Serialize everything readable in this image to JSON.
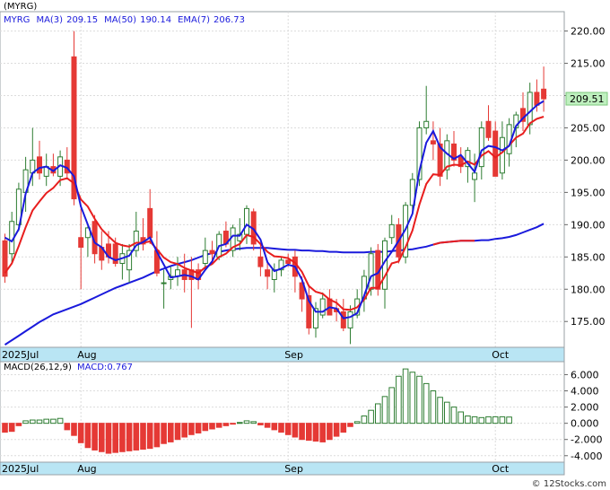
{
  "header": {
    "title": "(MYRG)"
  },
  "footer": {
    "credit": "© 12Stocks.com"
  },
  "colors": {
    "up": "#2e7d32",
    "down": "#e53935",
    "ma3": "#1a1adc",
    "ma50": "#1a1adc",
    "ema7": "#e81e1e",
    "macd_neg": "#e53935",
    "macd_pos": "#2e7d32",
    "axis_band": "#b9e5f4",
    "price_tag": "#bff0bf"
  },
  "chart_data": [
    {
      "type": "candlestick",
      "legend": [
        {
          "label": "MYRG",
          "value": ""
        },
        {
          "label": "MA(3)",
          "value": "209.15"
        },
        {
          "label": "MA(50)",
          "value": "190.14"
        },
        {
          "label": "EMA(7)",
          "value": "206.73"
        }
      ],
      "ylim": [
        171,
        223
      ],
      "yticks": [
        "220.00",
        "215.00",
        "210.00",
        "205.00",
        "200.00",
        "195.00",
        "190.00",
        "185.00",
        "180.00",
        "175.00"
      ],
      "ytick_values": [
        220,
        215,
        210,
        205,
        200,
        195,
        190,
        185,
        180,
        175
      ],
      "xticks": [
        {
          "label": "2025Jul",
          "index": 0
        },
        {
          "label": "Aug",
          "index": 11
        },
        {
          "label": "Sep",
          "index": 41
        },
        {
          "label": "Oct",
          "index": 71
        }
      ],
      "last_price": "209.51",
      "last_price_value": 209.51,
      "ohlc": [
        [
          187.5,
          188.6,
          181.0,
          182.0
        ],
        [
          185.5,
          192.0,
          184.0,
          190.5
        ],
        [
          190.0,
          196.5,
          189.0,
          195.5
        ],
        [
          195.0,
          200.5,
          192.0,
          198.5
        ],
        [
          198.0,
          205.0,
          196.0,
          200.0
        ],
        [
          200.5,
          203.0,
          197.0,
          198.0
        ],
        [
          197.5,
          201.0,
          196.0,
          199.0
        ],
        [
          199.0,
          201.0,
          197.5,
          198.0
        ],
        [
          197.5,
          201.5,
          196.0,
          200.5
        ],
        [
          200.0,
          202.0,
          197.0,
          198.0
        ],
        [
          216.0,
          220.0,
          193.0,
          194.0
        ],
        [
          188.0,
          192.5,
          180.0,
          186.5
        ],
        [
          188.0,
          190.0,
          185.0,
          189.5
        ],
        [
          190.5,
          191.5,
          184.0,
          185.5
        ],
        [
          186.5,
          189.0,
          183.0,
          184.5
        ],
        [
          187.0,
          189.0,
          184.0,
          185.0
        ],
        [
          187.0,
          188.0,
          183.5,
          184.0
        ],
        [
          184.0,
          187.0,
          181.5,
          185.5
        ],
        [
          183.0,
          187.0,
          181.0,
          186.0
        ],
        [
          186.0,
          192.0,
          185.0,
          189.0
        ],
        [
          188.0,
          191.0,
          186.0,
          187.0
        ],
        [
          192.5,
          195.5,
          187.0,
          188.0
        ],
        [
          186.0,
          189.0,
          182.0,
          182.5
        ],
        [
          181.0,
          183.0,
          177.0,
          181.0
        ],
        [
          181.5,
          183.5,
          180.0,
          182.0
        ],
        [
          182.0,
          185.0,
          180.5,
          183.0
        ],
        [
          183.0,
          185.5,
          179.5,
          181.5
        ],
        [
          183.0,
          185.0,
          174.0,
          181.5
        ],
        [
          183.0,
          184.0,
          180.0,
          181.5
        ],
        [
          184.0,
          188.0,
          183.0,
          186.0
        ],
        [
          186.0,
          187.5,
          184.0,
          185.5
        ],
        [
          185.0,
          189.0,
          184.5,
          188.5
        ],
        [
          189.0,
          190.5,
          186.5,
          187.0
        ],
        [
          186.0,
          190.0,
          185.0,
          189.5
        ],
        [
          187.5,
          191.0,
          186.0,
          188.5
        ],
        [
          188.5,
          193.0,
          187.0,
          192.5
        ],
        [
          192.0,
          192.5,
          186.0,
          187.0
        ],
        [
          185.0,
          187.0,
          182.0,
          183.5
        ],
        [
          183.0,
          184.5,
          180.0,
          182.0
        ],
        [
          181.5,
          184.0,
          179.5,
          183.0
        ],
        [
          183.0,
          185.0,
          182.0,
          184.5
        ],
        [
          184.5,
          185.5,
          183.5,
          184.0
        ],
        [
          185.0,
          186.0,
          179.5,
          182.0
        ],
        [
          181.0,
          182.0,
          176.5,
          178.5
        ],
        [
          179.0,
          180.5,
          173.0,
          174.0
        ],
        [
          174.0,
          178.0,
          172.5,
          177.0
        ],
        [
          176.0,
          179.5,
          175.5,
          178.5
        ],
        [
          178.5,
          180.0,
          176.0,
          176.0
        ],
        [
          177.0,
          178.5,
          175.0,
          176.5
        ],
        [
          176.5,
          178.5,
          173.5,
          174.0
        ],
        [
          174.0,
          177.5,
          171.5,
          176.5
        ],
        [
          176.0,
          180.0,
          175.5,
          178.5
        ],
        [
          178.5,
          183.0,
          176.5,
          182.0
        ],
        [
          180.0,
          186.5,
          179.0,
          185.5
        ],
        [
          186.0,
          187.0,
          179.0,
          180.0
        ],
        [
          180.0,
          188.0,
          177.0,
          187.5
        ],
        [
          188.0,
          191.5,
          187.0,
          190.0
        ],
        [
          190.0,
          191.0,
          184.0,
          185.0
        ],
        [
          185.0,
          193.5,
          184.0,
          193.0
        ],
        [
          193.0,
          198.0,
          192.0,
          197.0
        ],
        [
          197.0,
          206.0,
          196.0,
          205.0
        ],
        [
          205.0,
          211.5,
          204.0,
          206.0
        ],
        [
          203.0,
          206.0,
          200.0,
          202.5
        ],
        [
          202.5,
          205.0,
          196.0,
          197.5
        ],
        [
          198.5,
          204.0,
          197.0,
          203.0
        ],
        [
          202.5,
          204.5,
          199.0,
          200.0
        ],
        [
          200.5,
          202.0,
          198.0,
          199.0
        ],
        [
          199.0,
          202.0,
          196.5,
          201.5
        ],
        [
          197.0,
          201.0,
          193.5,
          198.0
        ],
        [
          199.0,
          206.0,
          197.0,
          205.0
        ],
        [
          206.0,
          208.5,
          203.0,
          203.5
        ],
        [
          204.5,
          206.0,
          197.5,
          197.5
        ],
        [
          198.0,
          206.0,
          197.0,
          203.5
        ],
        [
          201.0,
          206.5,
          199.0,
          205.5
        ],
        [
          205.0,
          207.5,
          202.0,
          207.0
        ],
        [
          208.0,
          210.5,
          204.5,
          206.0
        ],
        [
          205.5,
          212.0,
          204.0,
          210.5
        ],
        [
          210.5,
          212.5,
          207.5,
          208.5
        ],
        [
          211.0,
          214.5,
          207.5,
          209.5
        ]
      ],
      "ma3": [
        188.0,
        187.4,
        189.3,
        194.8,
        198.0,
        198.8,
        199.0,
        198.3,
        199.2,
        198.8,
        197.5,
        192.8,
        190.0,
        187.2,
        186.5,
        185.0,
        184.5,
        184.8,
        185.2,
        186.8,
        187.3,
        188.0,
        185.8,
        183.8,
        181.8,
        182.0,
        182.2,
        182.0,
        181.5,
        183.0,
        184.3,
        186.7,
        187.0,
        188.3,
        188.3,
        190.0,
        189.3,
        187.7,
        184.2,
        182.8,
        183.2,
        183.8,
        183.5,
        181.5,
        178.2,
        176.5,
        176.5,
        177.2,
        177.0,
        175.5,
        175.7,
        176.3,
        179.0,
        182.0,
        182.5,
        184.3,
        185.8,
        187.5,
        189.3,
        191.7,
        198.3,
        202.7,
        204.5,
        202.0,
        201.0,
        200.2,
        200.8,
        199.5,
        198.2,
        201.5,
        202.2,
        202.0,
        201.5,
        202.2,
        205.3,
        206.5,
        207.5,
        208.5,
        209.15
      ],
      "ema7": [
        182.5,
        184.0,
        186.7,
        189.6,
        192.2,
        193.6,
        194.9,
        195.7,
        196.9,
        197.2,
        196.4,
        193.9,
        192.8,
        190.9,
        189.3,
        188.2,
        187.2,
        186.8,
        186.6,
        187.2,
        187.2,
        187.4,
        186.2,
        184.9,
        184.2,
        183.9,
        183.3,
        182.9,
        182.5,
        183.4,
        183.9,
        185.0,
        185.5,
        186.5,
        187.0,
        188.4,
        188.1,
        187.0,
        185.8,
        185.1,
        185.0,
        184.8,
        184.1,
        182.7,
        180.5,
        179.6,
        179.3,
        178.4,
        177.9,
        176.9,
        176.8,
        177.2,
        178.4,
        180.2,
        180.2,
        182.0,
        184.0,
        184.3,
        186.5,
        189.1,
        193.1,
        196.3,
        197.8,
        197.7,
        199.0,
        199.3,
        199.2,
        199.8,
        199.3,
        200.7,
        201.4,
        200.4,
        201.2,
        202.3,
        203.5,
        204.1,
        205.7,
        206.4,
        206.73
      ],
      "ma50": [
        171.4,
        172.1,
        172.8,
        173.5,
        174.2,
        174.9,
        175.5,
        176.1,
        176.5,
        176.9,
        177.3,
        177.7,
        178.2,
        178.7,
        179.2,
        179.7,
        180.2,
        180.6,
        181.0,
        181.4,
        181.8,
        182.3,
        182.8,
        183.2,
        183.6,
        183.9,
        184.2,
        184.5,
        184.9,
        185.3,
        185.6,
        185.8,
        186.0,
        186.2,
        186.3,
        186.4,
        186.4,
        186.4,
        186.4,
        186.3,
        186.2,
        186.1,
        186.1,
        186.0,
        186.0,
        185.9,
        185.9,
        185.8,
        185.8,
        185.7,
        185.7,
        185.7,
        185.7,
        185.8,
        185.8,
        185.8,
        185.9,
        186.0,
        186.1,
        186.2,
        186.4,
        186.6,
        186.9,
        187.2,
        187.3,
        187.4,
        187.5,
        187.5,
        187.5,
        187.6,
        187.6,
        187.8,
        187.9,
        188.1,
        188.4,
        188.8,
        189.2,
        189.6,
        190.14
      ]
    },
    {
      "type": "bar",
      "legend": [
        {
          "label": "MACD(26,12,9)",
          "value": ""
        },
        {
          "label": "MACD:",
          "value": "0.767"
        }
      ],
      "ylim": [
        -4.8,
        7.6
      ],
      "yticks": [
        "6.000",
        "4.000",
        "2.000",
        "0.000",
        "-2.000",
        "-4.000"
      ],
      "ytick_values": [
        6,
        4,
        2,
        0,
        -2,
        -4
      ],
      "xticks": [
        {
          "label": "2025Jul",
          "index": 0
        },
        {
          "label": "Aug",
          "index": 11
        },
        {
          "label": "Sep",
          "index": 41
        },
        {
          "label": "Oct",
          "index": 71
        }
      ],
      "values": [
        -1.1,
        -1.0,
        -0.3,
        0.3,
        0.4,
        0.4,
        0.5,
        0.5,
        0.6,
        -0.8,
        -1.5,
        -2.4,
        -3.0,
        -3.3,
        -3.5,
        -3.7,
        -3.6,
        -3.5,
        -3.4,
        -3.3,
        -3.2,
        -3.1,
        -2.9,
        -2.5,
        -2.3,
        -2.0,
        -1.7,
        -1.4,
        -1.2,
        -0.9,
        -0.7,
        -0.5,
        -0.3,
        -0.1,
        0.1,
        0.3,
        0.2,
        -0.2,
        -0.5,
        -0.8,
        -1.1,
        -1.4,
        -1.7,
        -2.0,
        -2.1,
        -2.2,
        -2.3,
        -2.0,
        -1.6,
        -1.1,
        -0.4,
        0.2,
        0.9,
        1.6,
        2.4,
        3.3,
        4.4,
        5.8,
        6.7,
        6.3,
        5.8,
        4.9,
        4.0,
        3.2,
        2.6,
        2.0,
        1.4,
        0.9,
        0.8,
        0.7,
        0.8,
        0.8,
        0.8,
        0.767
      ]
    }
  ]
}
